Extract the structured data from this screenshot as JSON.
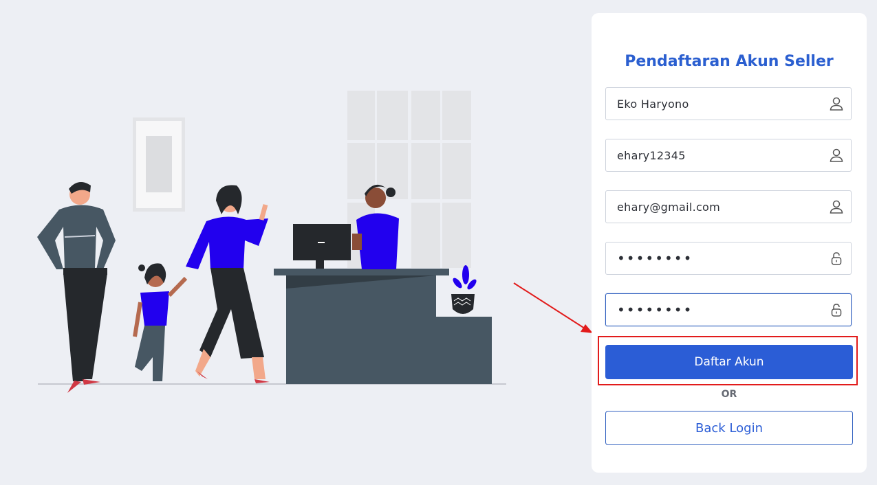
{
  "form": {
    "title": "Pendaftaran Akun Seller",
    "fields": [
      {
        "value": "Eko Haryono",
        "icon": "user-icon"
      },
      {
        "value": "ehary12345",
        "icon": "user-icon"
      },
      {
        "value": "ehary@gmail.com",
        "icon": "user-icon"
      },
      {
        "value": "••••••••",
        "icon": "lock-icon"
      },
      {
        "value": "••••••••",
        "icon": "lock-icon"
      }
    ],
    "submit_label": "Daftar Akun",
    "or_label": "OR",
    "back_label": "Back Login"
  },
  "colors": {
    "background": "#edeff4",
    "brand": "#2b5dd6",
    "title": "#2b5fd0",
    "accent_purple": "#2200ee",
    "annotation_red": "#e21b1b"
  }
}
